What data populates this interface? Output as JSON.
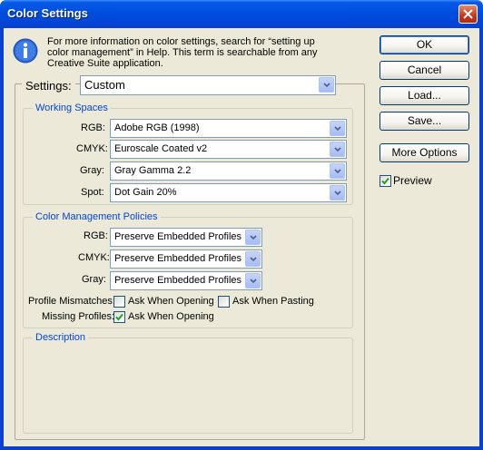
{
  "window": {
    "title": "Color Settings"
  },
  "info": {
    "text": "For more information on color settings, search for “setting up color management” in Help. This term is searchable from any Creative Suite application."
  },
  "buttons": {
    "ok": "OK",
    "cancel": "Cancel",
    "load": "Load...",
    "save": "Save...",
    "more_options": "More Options"
  },
  "preview": {
    "label": "Preview",
    "checked": true
  },
  "settings": {
    "label": "Settings:",
    "value": "Custom"
  },
  "working_spaces": {
    "title": "Working Spaces",
    "rgb": {
      "label": "RGB:",
      "value": "Adobe RGB (1998)"
    },
    "cmyk": {
      "label": "CMYK:",
      "value": "Euroscale Coated v2"
    },
    "gray": {
      "label": "Gray:",
      "value": "Gray Gamma 2.2"
    },
    "spot": {
      "label": "Spot:",
      "value": "Dot Gain 20%"
    }
  },
  "policies": {
    "title": "Color Management Policies",
    "rgb": {
      "label": "RGB:",
      "value": "Preserve Embedded Profiles"
    },
    "cmyk": {
      "label": "CMYK:",
      "value": "Preserve Embedded Profiles"
    },
    "gray": {
      "label": "Gray:",
      "value": "Preserve Embedded Profiles"
    },
    "profile_mismatches": {
      "label": "Profile Mismatches:",
      "ask_opening": "Ask When Opening",
      "ask_opening_checked": false,
      "ask_pasting": "Ask When Pasting",
      "ask_pasting_checked": false
    },
    "missing_profiles": {
      "label": "Missing Profiles:",
      "ask_opening": "Ask When Opening",
      "ask_opening_checked": true
    }
  },
  "description": {
    "title": "Description"
  },
  "colors": {
    "title_bar": "#0054e3",
    "dialog_bg": "#ece9d8",
    "group_title": "#0046d5",
    "check_mark": "#21a121"
  }
}
